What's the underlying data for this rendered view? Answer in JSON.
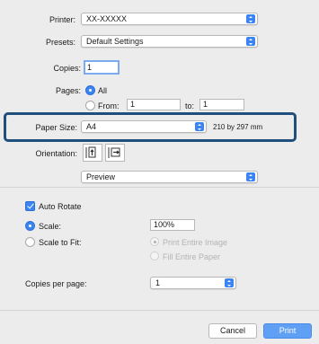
{
  "printer": {
    "label": "Printer:",
    "value": "XX-XXXXX"
  },
  "presets": {
    "label": "Presets:",
    "value": "Default Settings"
  },
  "copies": {
    "label": "Copies:",
    "value": "1"
  },
  "pages": {
    "label": "Pages:",
    "all_label": "All",
    "from_label": "From:",
    "from_value": "1",
    "to_label": "to:",
    "to_value": "1",
    "selected": "All"
  },
  "paper_size": {
    "label": "Paper Size:",
    "value": "A4",
    "dimensions": "210 by 297 mm"
  },
  "orientation": {
    "label": "Orientation:",
    "options": [
      "portrait-icon",
      "landscape-icon"
    ],
    "selected": "portrait"
  },
  "section_popup": {
    "value": "Preview"
  },
  "preview": {
    "auto_rotate_label": "Auto Rotate",
    "auto_rotate_checked": true,
    "scale_label": "Scale:",
    "scale_value": "100%",
    "scale_to_fit_label": "Scale to Fit:",
    "print_entire_image_label": "Print Entire Image",
    "fill_entire_paper_label": "Fill Entire Paper",
    "copies_per_page_label": "Copies per page:",
    "copies_per_page_value": "1"
  },
  "buttons": {
    "cancel": "Cancel",
    "print": "Print"
  },
  "colors": {
    "accent": "#3b84f3",
    "highlight_border": "#1f4f7a",
    "background": "#ececec"
  }
}
